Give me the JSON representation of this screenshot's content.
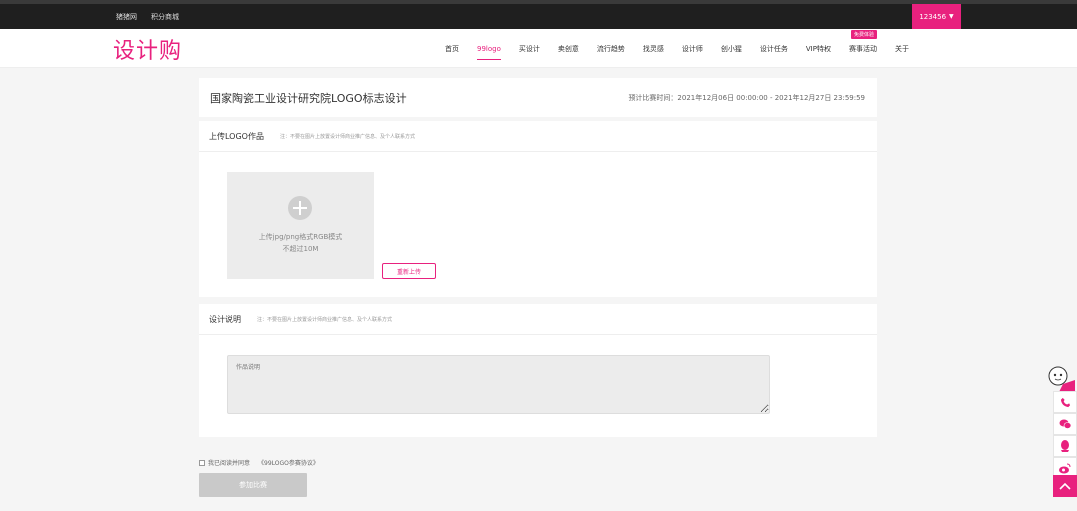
{
  "topbar": {
    "links": [
      "猪猪网",
      "积分商城"
    ],
    "username": "123456"
  },
  "header": {
    "logo": "设计购",
    "nav": [
      "首页",
      "99logo",
      "买设计",
      "卖创意",
      "流行趋势",
      "找灵感",
      "设计师",
      "创小猩",
      "设计任务",
      "VIP特权",
      "赛事活动",
      "关于"
    ],
    "active_nav": "99logo",
    "vip_badge": "免费体验"
  },
  "contest": {
    "title": "国家陶瓷工业设计研究院LOGO标志设计",
    "time_label": "预计比赛时间：2021年12月06日 00:00:00 - 2021年12月27日 23:59:59"
  },
  "upload": {
    "title": "上传LOGO作品",
    "note": "注：不要在图片上放置设计师商业推广信息、及个人联系方式",
    "hint_line1": "上传jpg/png格式RGB模式",
    "hint_line2": "不超过10M",
    "reupload_label": "重新上传"
  },
  "description": {
    "title": "设计说明",
    "note": "注：不要在图片上放置设计师商业推广信息、及个人联系方式",
    "placeholder": "作品说明"
  },
  "agreement": {
    "label": "我已阅读并同意",
    "link": "《99LOGO参赛协议》"
  },
  "submit_label": "参加比赛",
  "side_icons": [
    "mascot-icon",
    "phone-icon",
    "wechat-icon",
    "qq-icon",
    "weibo-icon",
    "back-to-top-icon"
  ],
  "colors": {
    "accent": "#e8217e",
    "topbar": "#1f1f1f",
    "disabled": "#c9c9c9"
  }
}
